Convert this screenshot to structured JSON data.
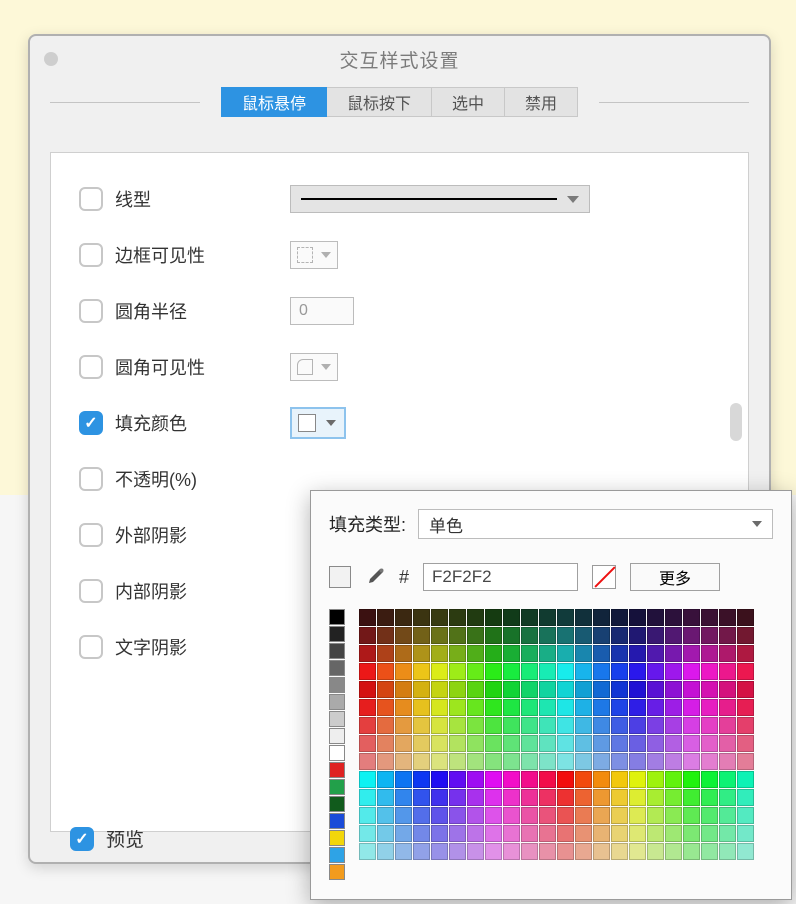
{
  "window": {
    "title": "交互样式设置"
  },
  "tabs": {
    "items": [
      {
        "label": "鼠标悬停",
        "active": true
      },
      {
        "label": "鼠标按下",
        "active": false
      },
      {
        "label": "选中",
        "active": false
      },
      {
        "label": "禁用",
        "active": false
      }
    ]
  },
  "props": {
    "line_type": {
      "label": "线型",
      "checked": false
    },
    "border_vis": {
      "label": "边框可见性",
      "checked": false
    },
    "corner_radius": {
      "label": "圆角半径",
      "checked": false,
      "value": "0"
    },
    "corner_vis": {
      "label": "圆角可见性",
      "checked": false
    },
    "fill_color": {
      "label": "填充颜色",
      "checked": true
    },
    "opacity": {
      "label": "不透明(%)",
      "checked": false
    },
    "outer_shadow": {
      "label": "外部阴影",
      "checked": false
    },
    "inner_shadow": {
      "label": "内部阴影",
      "checked": false
    },
    "text_shadow": {
      "label": "文字阴影",
      "checked": false
    }
  },
  "preview": {
    "label": "预览",
    "checked": true
  },
  "color_popup": {
    "fill_type_label": "填充类型:",
    "fill_type_value": "单色",
    "hash": "#",
    "hex_value": "F2F2F2",
    "more_label": "更多",
    "gray_swatches": [
      "#000000",
      "#222222",
      "#444444",
      "#666666",
      "#888888",
      "#aaaaaa",
      "#cccccc",
      "#eeeeee",
      "#ffffff",
      "#de2222",
      "#22a04a",
      "#115b1c",
      "#1a4bd8",
      "#f2d60a",
      "#2ea3e6",
      "#f29b1d"
    ]
  }
}
